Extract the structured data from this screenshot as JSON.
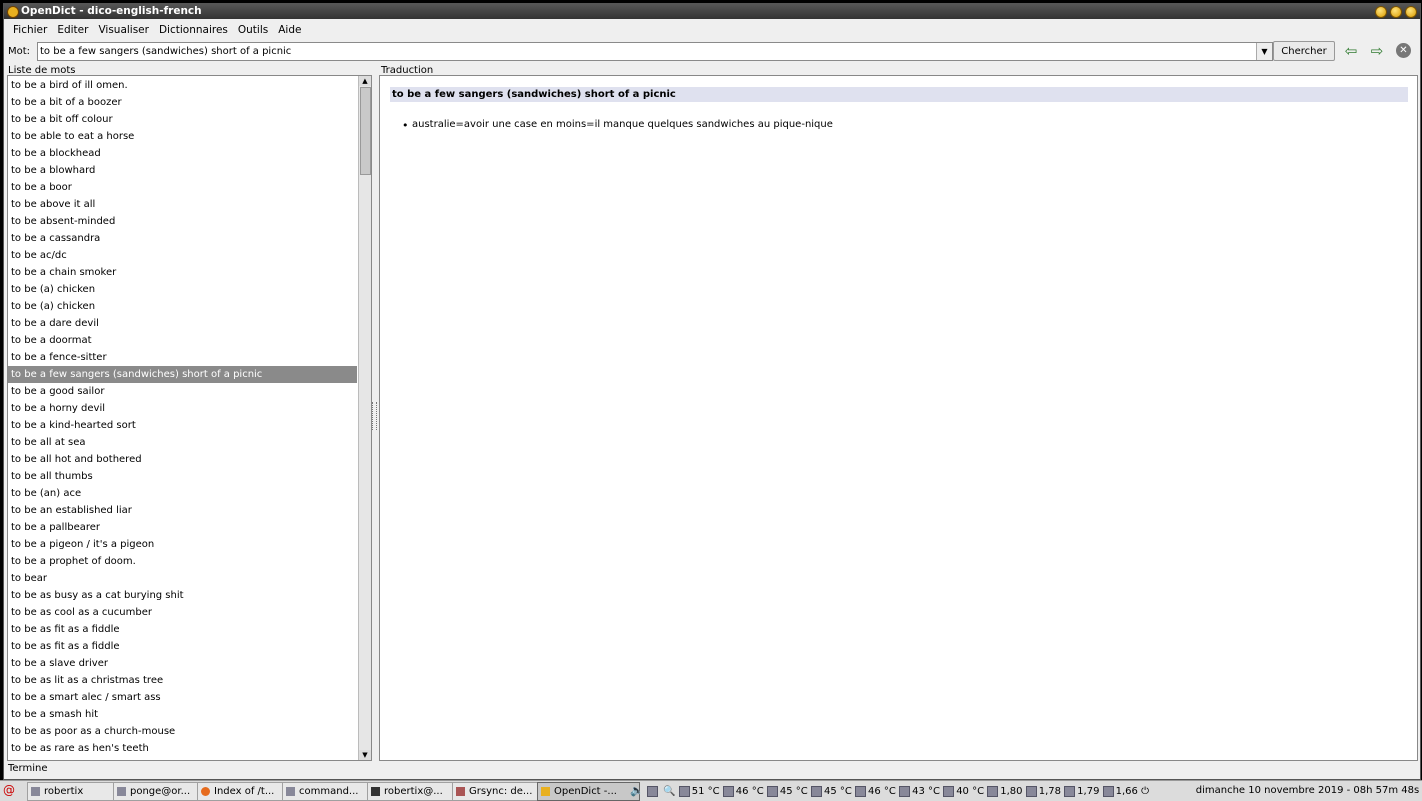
{
  "window": {
    "title": "OpenDict - dico-english-french"
  },
  "menu": [
    "Fichier",
    "Editer",
    "Visualiser",
    "Dictionnaires",
    "Outils",
    "Aide"
  ],
  "toolbar": {
    "mot_label": "Mot:",
    "mot_value": "to be a few sangers (sandwiches) short of a picnic",
    "search_button": "Chercher",
    "back_icon": "arrow-left-icon",
    "forward_icon": "arrow-right-icon",
    "close_icon": "close-icon"
  },
  "word_list": {
    "title": "Liste de mots",
    "selected_index": 17,
    "items": [
      "to be a bird of ill omen.",
      "to be a bit of a boozer",
      "to be a bit off colour",
      "to be able to eat a horse",
      "to be a blockhead",
      "to be a blowhard",
      "to be a boor",
      "to be above it all",
      "to be absent-minded",
      "to be a cassandra",
      "to be ac/dc",
      "to be a chain smoker",
      "to be (a) chicken",
      "to be (a) chicken",
      "to be a dare devil",
      "to be a doormat",
      "to be a fence-sitter",
      "to be a few sangers (sandwiches) short of a picnic",
      "to be a good sailor",
      "to be a horny devil",
      "to be a kind-hearted sort",
      "to be all at sea",
      "to be all hot and bothered",
      "to be all thumbs",
      "to be (an) ace",
      "to be an established liar",
      "to be a pallbearer",
      "to be a pigeon / it's a pigeon",
      "to be a prophet of doom.",
      "to bear",
      "to be as busy as a cat burying shit",
      "to be as cool as a cucumber",
      "to be as fit as a fiddle",
      "to be as fit as a fiddle",
      "to be a slave driver",
      "to be as lit as a christmas tree",
      "to be a smart alec / smart ass",
      "to be a smash hit",
      "to be as poor as a church-mouse",
      "to be as rare as hen's teeth"
    ]
  },
  "translation": {
    "title": "Traduction",
    "headword": "to be a few sangers (sandwiches) short of a picnic",
    "entry": "australie=avoir une case en moins=il manque quelques sandwiches au pique-nique"
  },
  "status": "Termine",
  "taskbar": {
    "tasks": [
      "robertix",
      "ponge@or...",
      "Index of /t...",
      "command...",
      "robertix@...",
      "Grsync: de...",
      "OpenDict -..."
    ],
    "active_task": "OpenDict -...",
    "temps": [
      "51 °C",
      "46 °C",
      "45 °C",
      "45 °C",
      "46 °C",
      "43 °C",
      "40 °C"
    ],
    "loads": [
      "1,80",
      "1,78",
      "1,79",
      "1,66"
    ],
    "clock": "dimanche 10 novembre 2019 - 08h 57m 48s"
  }
}
